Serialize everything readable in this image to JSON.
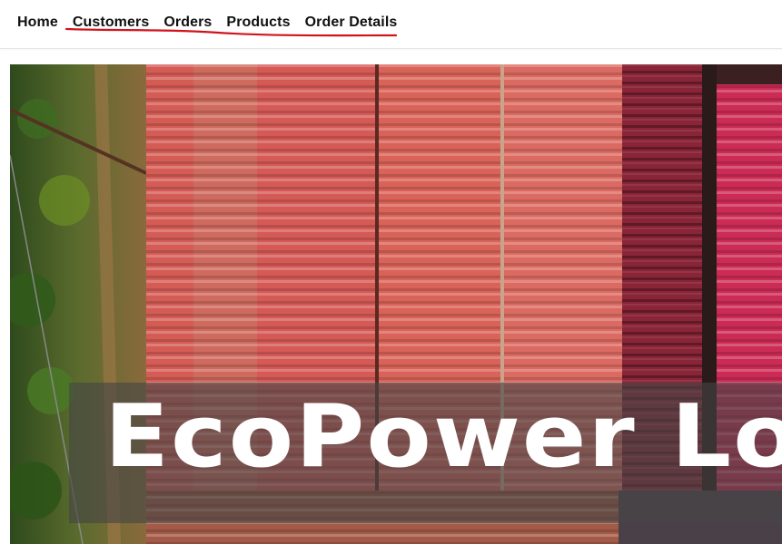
{
  "nav": {
    "items": [
      {
        "label": "Home"
      },
      {
        "label": "Customers"
      },
      {
        "label": "Orders"
      },
      {
        "label": "Products"
      },
      {
        "label": "Order Details"
      }
    ],
    "annotation_color": "#d0141b"
  },
  "hero": {
    "title": "EcoPower Logistics",
    "image": "shipping-containers-aerial-photo",
    "overlay_color": "rgba(70,70,70,0.62)"
  }
}
